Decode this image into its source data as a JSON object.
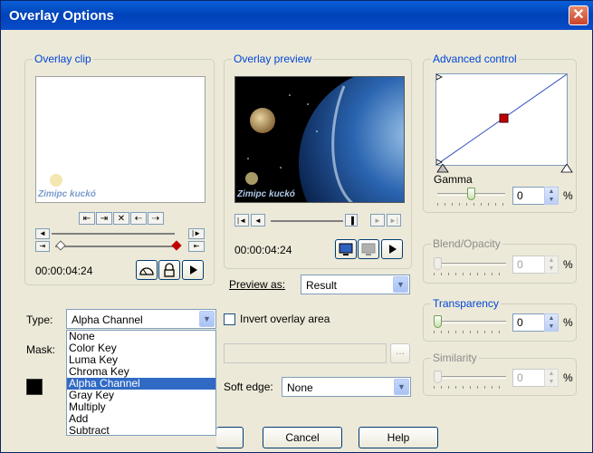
{
  "window": {
    "title": "Overlay Options",
    "close_glyph": "✕"
  },
  "overlay_clip": {
    "label": "Overlay clip",
    "watermark": "Zimipc kuckó",
    "timecode": "00:00:04:24"
  },
  "overlay_preview": {
    "label": "Overlay preview",
    "watermark": "Zimipc kuckó",
    "timecode": "00:00:04:24",
    "preview_as_label": "Preview as:",
    "preview_as_value": "Result"
  },
  "advanced_control": {
    "label": "Advanced control",
    "gamma_label": "Gamma",
    "gamma_value": "0",
    "gamma_level": 0.5,
    "pct": "%"
  },
  "blend_opacity": {
    "label": "Blend/Opacity",
    "value": "0",
    "pct": "%"
  },
  "transparency": {
    "label": "Transparency",
    "value": "0",
    "pct": "%"
  },
  "similarity": {
    "label": "Similarity",
    "value": "0",
    "pct": "%"
  },
  "type": {
    "label": "Type:",
    "value": "Alpha Channel",
    "options": [
      "None",
      "Color Key",
      "Luma Key",
      "Chroma Key",
      "Alpha Channel",
      "Gray Key",
      "Multiply",
      "Add",
      "Subtract"
    ],
    "selected_index": 4
  },
  "mask": {
    "label": "Mask:"
  },
  "invert": {
    "label": "Invert overlay area",
    "checked": false
  },
  "browse": {
    "label": "..."
  },
  "soft_edge": {
    "label": "Soft edge:",
    "value": "None"
  },
  "buttons": {
    "ok": "",
    "cancel": "Cancel",
    "help": "Help"
  },
  "colors": {
    "title_bar": "#0a4cc8",
    "selection": "#316ac5",
    "label_blue": "#0046d5",
    "key_marker": "#c00000"
  }
}
